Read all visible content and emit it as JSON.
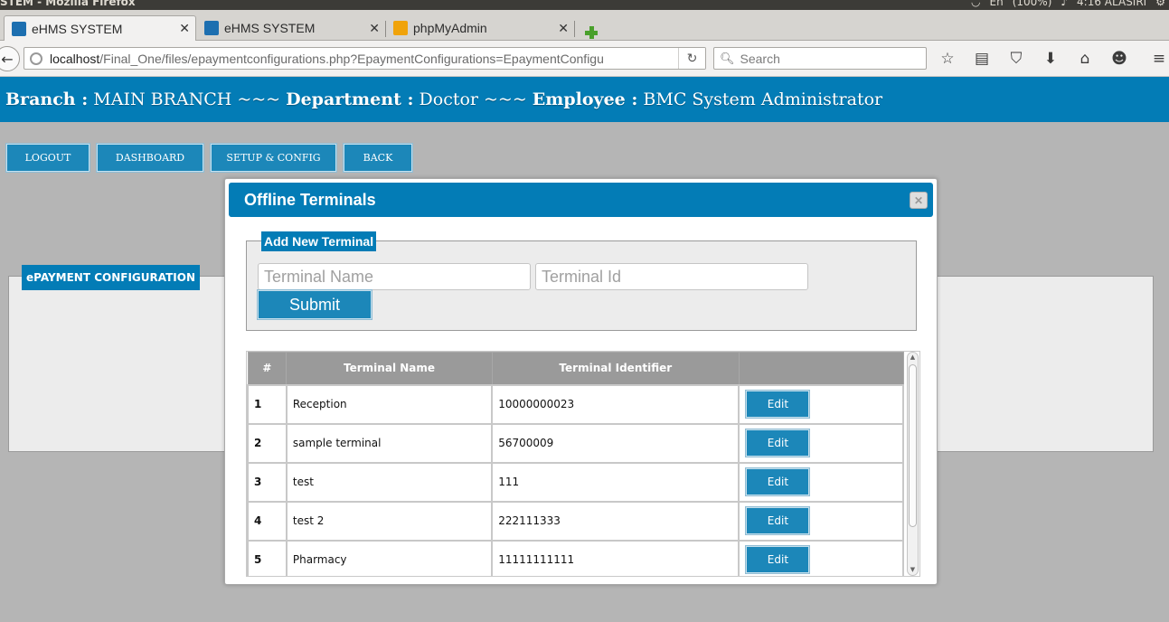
{
  "os": {
    "window_title": "STEM - Mozilla Firefox",
    "keyboard": "En",
    "battery": "(100%)",
    "clock": "4:16 ALASIRI"
  },
  "tabs": [
    {
      "label": "eHMS SYSTEM",
      "active": true
    },
    {
      "label": "eHMS SYSTEM",
      "active": false
    },
    {
      "label": "phpMyAdmin",
      "active": false
    }
  ],
  "tab_close_glyph": "✕",
  "nav": {
    "url_host": "localhost",
    "url_path": "/Final_One/files/epaymentconfigurations.php?EpaymentConfigurations=EpaymentConfigu",
    "search_placeholder": "Search"
  },
  "header": {
    "branch_label": "Branch :",
    "branch_value": "MAIN BRANCH",
    "separator": "~~~",
    "department_label": "Department :",
    "department_value": "Doctor",
    "employee_label": "Employee :",
    "employee_value": "BMC System Administrator"
  },
  "toolbar": {
    "logout": "LOGOUT",
    "dashboard": "DASHBOARD",
    "setup": "SETUP & CONFIG",
    "back": "BACK"
  },
  "page": {
    "section_legend": "ePAYMENT CONFIGURATION"
  },
  "modal": {
    "title": "Offline Terminals",
    "fieldset_legend": "Add New Terminal",
    "name_placeholder": "Terminal Name",
    "id_placeholder": "Terminal Id",
    "submit_label": "Submit",
    "table": {
      "headers": [
        "#",
        "Terminal Name",
        "Terminal Identifier",
        ""
      ],
      "edit_label": "Edit",
      "rows": [
        {
          "num": "1",
          "name": "Reception",
          "id": "10000000023"
        },
        {
          "num": "2",
          "name": "sample terminal",
          "id": "56700009"
        },
        {
          "num": "3",
          "name": "test",
          "id": "111"
        },
        {
          "num": "4",
          "name": "test 2",
          "id": "222111333"
        },
        {
          "num": "5",
          "name": "Pharmacy",
          "id": "11111111111"
        }
      ]
    }
  },
  "colors": {
    "brand_blue": "#037cb6",
    "button_blue": "#1c87b9",
    "page_gray": "#b5b5b5"
  }
}
